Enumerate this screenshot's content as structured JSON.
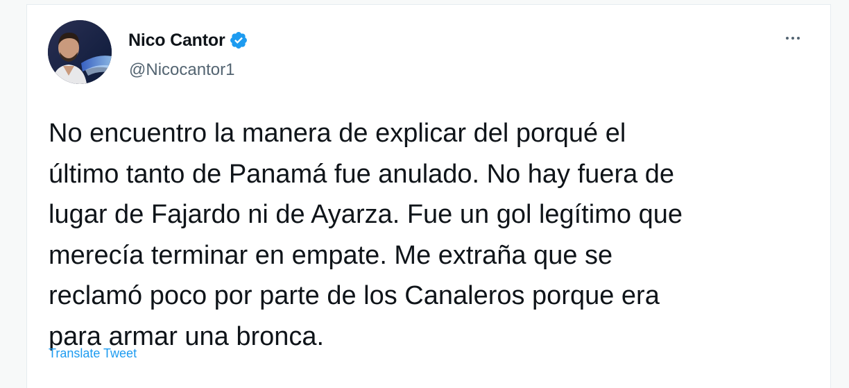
{
  "author": {
    "name": "Nico Cantor",
    "handle": "@Nicocantor1",
    "verified": true
  },
  "tweet": {
    "lines": [
      "No encuentro la manera de explicar del porqué el",
      "último tanto de Panamá fue anulado. No hay fuera de",
      "lugar de Fajardo ni de Ayarza. Fue un gol legítimo que",
      "merecía terminar en empate. Me extraña que se",
      "reclamó poco por parte de los Canaleros porque era",
      "para armar una bronca."
    ],
    "translate_label": "Translate Tweet"
  },
  "icons": {
    "more": "more-options-icon",
    "verified": "verified-badge-icon"
  },
  "colors": {
    "accent": "#1d9bf0",
    "text": "#0f1419",
    "secondary_text": "#536471"
  }
}
